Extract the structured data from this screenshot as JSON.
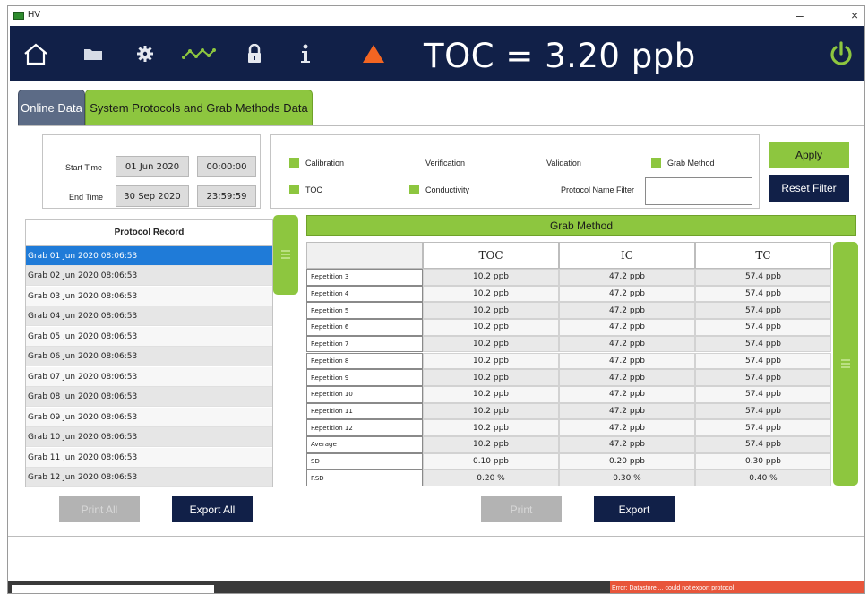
{
  "window": {
    "title": "HV",
    "minimize": "–",
    "close": "×"
  },
  "header": {
    "toc_reading": "TOC = 3.20 ppb",
    "icons": [
      "home-icon",
      "folder-icon",
      "gear-icon",
      "trend-icon",
      "lock-icon",
      "info-icon",
      "warning-icon",
      "power-icon"
    ]
  },
  "tabs": [
    {
      "label": "Online Data"
    },
    {
      "label": "System Protocols and Grab Methods Data"
    }
  ],
  "time_filter": {
    "start_label": "Start Time",
    "start_date": "01 Jun 2020",
    "start_time": "00:00:00",
    "end_label": "End Time",
    "end_date": "30 Sep 2020",
    "end_time": "23:59:59"
  },
  "filters": {
    "calibration": {
      "label": "Calibration",
      "checked": true
    },
    "verification": {
      "label": "Verification",
      "checked": false
    },
    "validation": {
      "label": "Validation",
      "checked": false
    },
    "grab_method": {
      "label": "Grab Method",
      "checked": true
    },
    "toc": {
      "label": "TOC",
      "checked": true
    },
    "conductivity": {
      "label": "Conductivity",
      "checked": true
    },
    "protocol_name_filter_label": "Protocol Name Filter",
    "protocol_name_filter_value": ""
  },
  "buttons": {
    "apply": "Apply",
    "reset_filter": "Reset Filter",
    "print_all": "Print All",
    "export_all": "Export All",
    "print": "Print",
    "export": "Export"
  },
  "protocol_record": {
    "header": "Protocol Record",
    "items": [
      "Grab 01 Jun 2020 08:06:53",
      "Grab 02 Jun 2020 08:06:53",
      "Grab 03 Jun 2020 08:06:53",
      "Grab 04 Jun 2020 08:06:53",
      "Grab 05 Jun 2020 08:06:53",
      "Grab 06 Jun 2020 08:06:53",
      "Grab 07 Jun 2020 08:06:53",
      "Grab 08 Jun 2020 08:06:53",
      "Grab 09 Jun 2020 08:06:53",
      "Grab 10 Jun 2020 08:06:53",
      "Grab 11 Jun 2020 08:06:53",
      "Grab 12 Jun 2020 08:06:53"
    ],
    "selected_index": 0
  },
  "grab_table": {
    "title": "Grab Method",
    "columns": [
      "TOC",
      "IC",
      "TC"
    ],
    "rows": [
      {
        "label": "Repetition 3",
        "toc": "10.2 ppb",
        "ic": "47.2 ppb",
        "tc": "57.4 ppb"
      },
      {
        "label": "Repetition 4",
        "toc": "10.2 ppb",
        "ic": "47.2 ppb",
        "tc": "57.4 ppb"
      },
      {
        "label": "Repetition 5",
        "toc": "10.2 ppb",
        "ic": "47.2 ppb",
        "tc": "57.4 ppb"
      },
      {
        "label": "Repetition 6",
        "toc": "10.2 ppb",
        "ic": "47.2 ppb",
        "tc": "57.4 ppb"
      },
      {
        "label": "Repetition 7",
        "toc": "10.2 ppb",
        "ic": "47.2 ppb",
        "tc": "57.4 ppb"
      },
      {
        "label": "Repetition 8",
        "toc": "10.2 ppb",
        "ic": "47.2 ppb",
        "tc": "57.4 ppb"
      },
      {
        "label": "Repetition 9",
        "toc": "10.2 ppb",
        "ic": "47.2 ppb",
        "tc": "57.4 ppb"
      },
      {
        "label": "Repetition 10",
        "toc": "10.2 ppb",
        "ic": "47.2 ppb",
        "tc": "57.4 ppb"
      },
      {
        "label": "Repetition 11",
        "toc": "10.2 ppb",
        "ic": "47.2 ppb",
        "tc": "57.4 ppb"
      },
      {
        "label": "Repetition 12",
        "toc": "10.2 ppb",
        "ic": "47.2 ppb",
        "tc": "57.4 ppb"
      },
      {
        "label": "Average",
        "toc": "10.2 ppb",
        "ic": "47.2 ppb",
        "tc": "57.4 ppb"
      },
      {
        "label": "SD",
        "toc": "0.10 ppb",
        "ic": "0.20 ppb",
        "tc": "0.30 ppb"
      },
      {
        "label": "RSD",
        "toc": "0.20 %",
        "ic": "0.30 %",
        "tc": "0.40 %"
      }
    ]
  },
  "status_bar": {
    "error_text": "Error: Datastore ... could not export protocol"
  },
  "colors": {
    "navy": "#112048",
    "green": "#8dc63f",
    "selected_blue": "#1f7bd8",
    "warning_orange": "#f26522",
    "error_red": "#e8553a"
  }
}
